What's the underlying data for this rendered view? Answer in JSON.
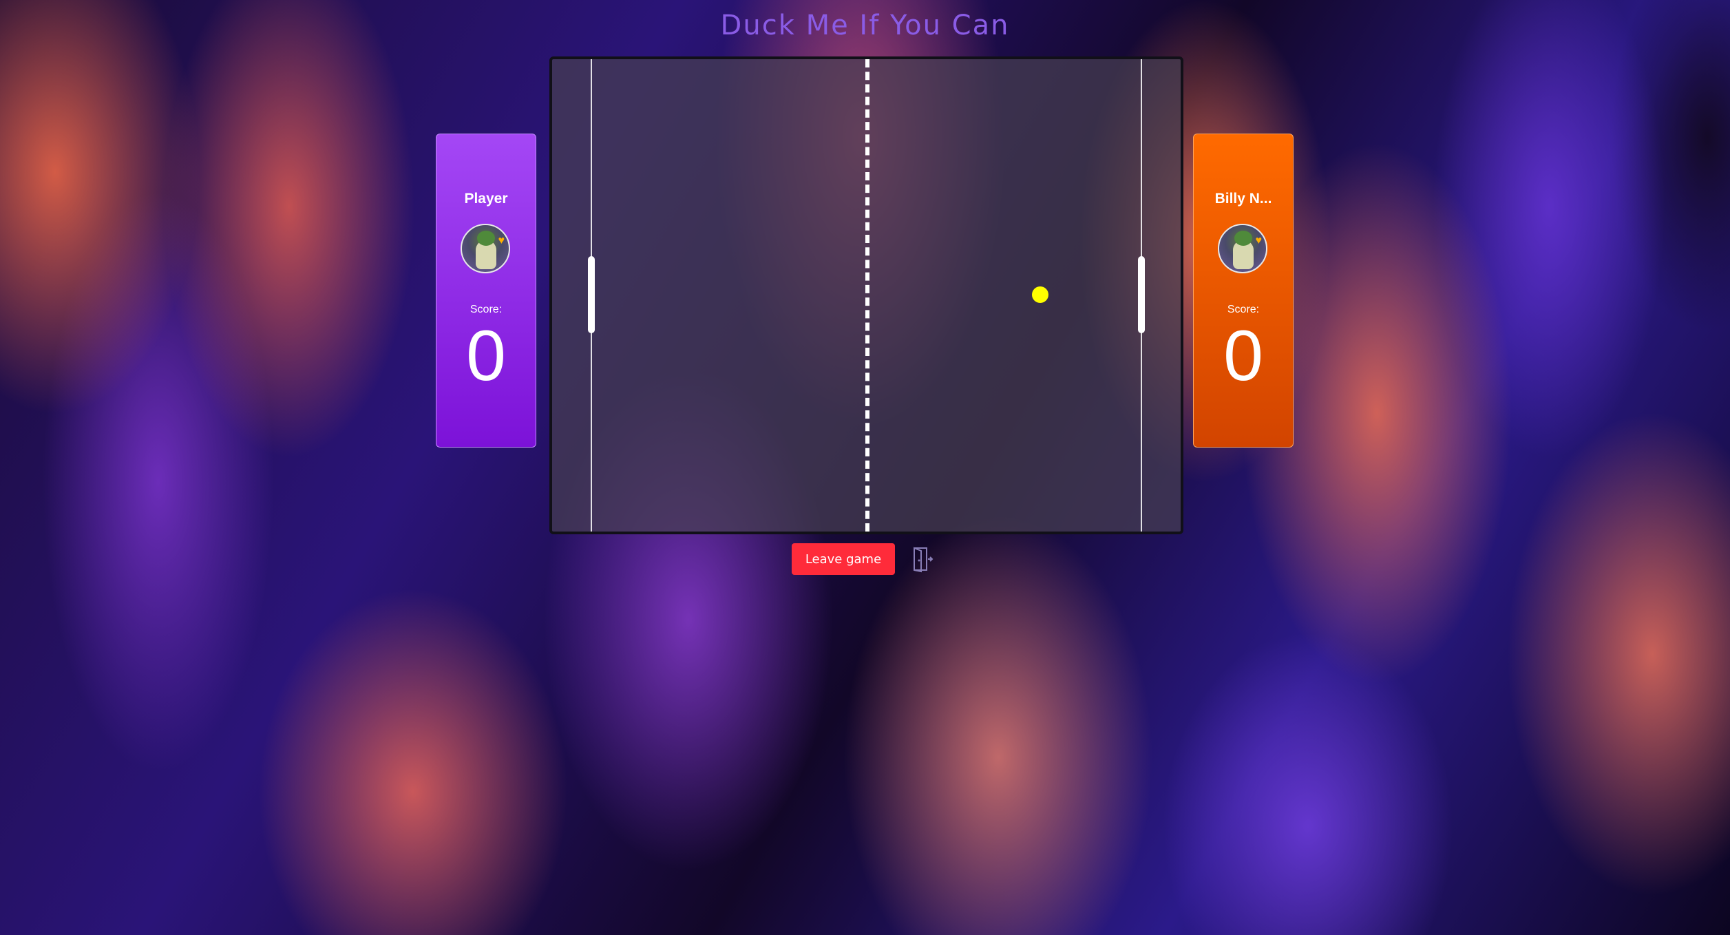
{
  "title": "Duck Me If You Can",
  "player": {
    "name": "Player",
    "score_label": "Score:",
    "score": "0",
    "avatar_icon": "duck-avatar-icon",
    "color": "#9b30ff"
  },
  "opponent": {
    "name": "Billy N...",
    "score_label": "Score:",
    "score": "0",
    "avatar_icon": "duck-avatar-icon",
    "color": "#ff6a00"
  },
  "controls": {
    "leave_label": "Leave game",
    "exit_icon": "exit-door-icon"
  },
  "colors": {
    "ball": "#ffff00",
    "leave_button": "#ff2b3a",
    "title": "#8a5ce6"
  }
}
